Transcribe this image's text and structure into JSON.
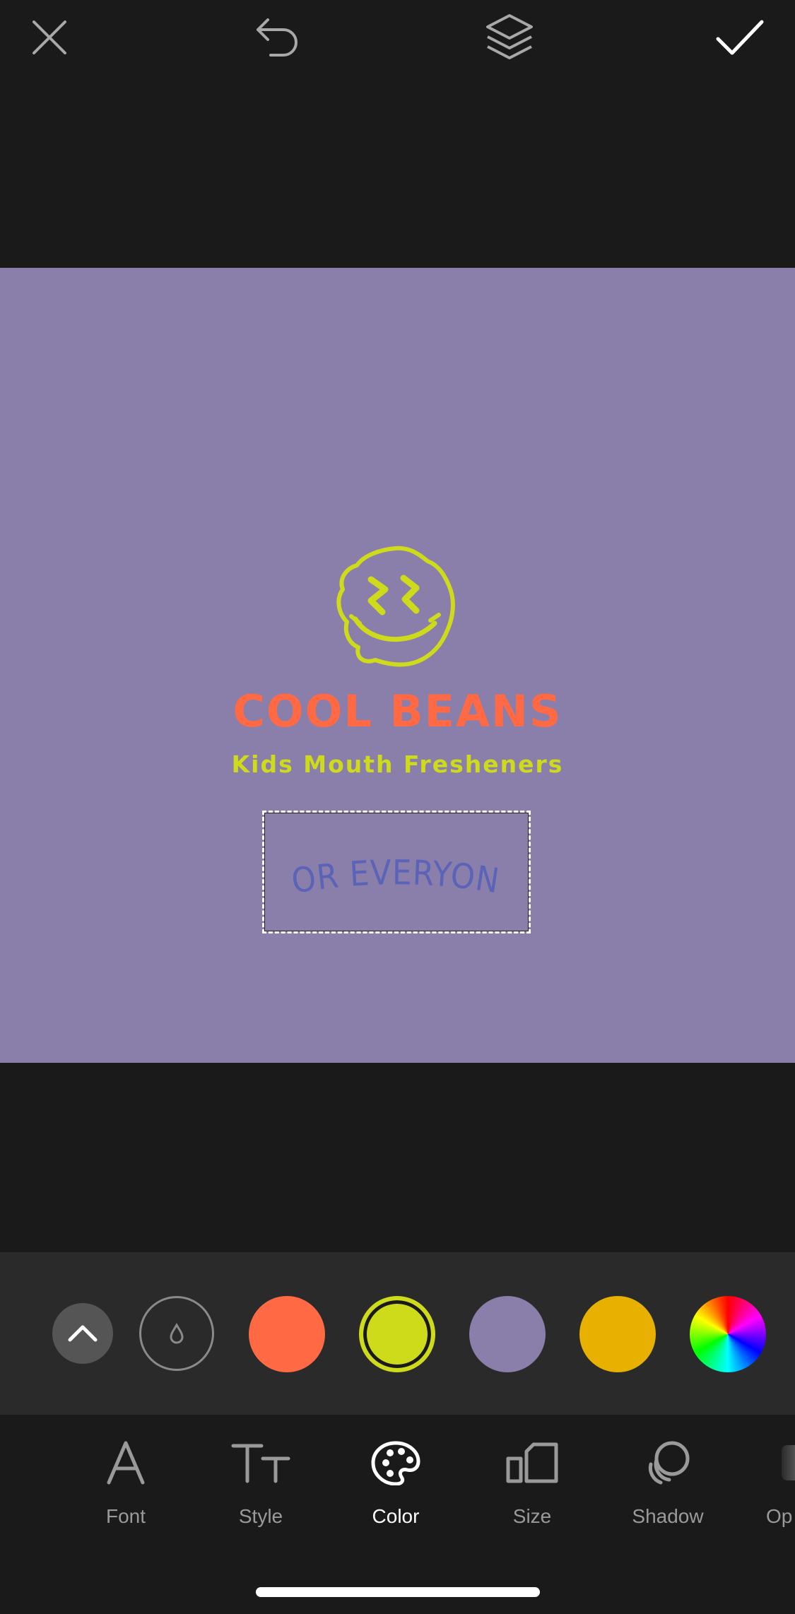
{
  "colors": {
    "background": "#1a1a1a",
    "canvas": "#8a7eaa",
    "logo_yellow": "#cedb1a",
    "title_orange": "#ff6a44",
    "selected_text_blue": "#5a63b8",
    "panel": "#2a2a2a",
    "tab_inactive": "#9a9a9a",
    "tab_active": "#ffffff"
  },
  "toolbar": {
    "close_icon": "close-icon",
    "undo_icon": "undo-icon",
    "layers_icon": "layers-icon",
    "confirm_icon": "checkmark-icon"
  },
  "design": {
    "icon": "smiley-face-icon",
    "title": "COOL BEANS",
    "subtitle": "Kids Mouth Fresheners",
    "selected_text": "FOR EVERYONE"
  },
  "palette": {
    "expand_icon": "chevron-up-icon",
    "eyedropper_icon": "drop-icon",
    "swatches": [
      {
        "color": "#ff6a44",
        "selected": false
      },
      {
        "color": "#cedb1a",
        "selected": true
      },
      {
        "color": "#8a7eaa",
        "selected": false
      },
      {
        "color": "#e8b000",
        "selected": false
      }
    ],
    "custom_icon": "color-wheel-icon"
  },
  "tabs": [
    {
      "label": "Font",
      "icon": "font-icon",
      "active": false
    },
    {
      "label": "Style",
      "icon": "text-style-icon",
      "active": false
    },
    {
      "label": "Color",
      "icon": "palette-icon",
      "active": true
    },
    {
      "label": "Size",
      "icon": "size-icon",
      "active": false
    },
    {
      "label": "Shadow",
      "icon": "shadow-icon",
      "active": false
    },
    {
      "label": "Op",
      "icon": "opacity-icon",
      "active": false
    }
  ]
}
